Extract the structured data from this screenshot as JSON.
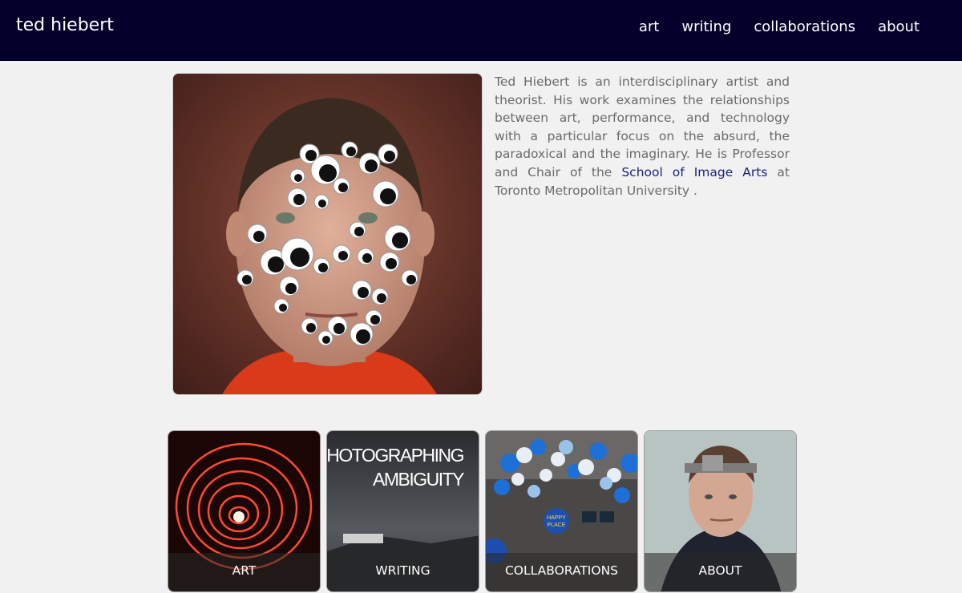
{
  "header": {
    "brand": "ted hiebert",
    "nav": [
      {
        "label": "art"
      },
      {
        "label": "writing"
      },
      {
        "label": "collaborations"
      },
      {
        "label": "about"
      }
    ]
  },
  "colors": {
    "header_bg": "#02002a",
    "page_bg": "#f1f1f1",
    "link": "#1a237e",
    "body_text": "#6a6a6a"
  },
  "bio": {
    "text_before_link": "Ted Hiebert is an interdisciplinary artist and theorist. His work examines the relationships between art, performance, and technology with a particular focus on the absurd, the paradoxical and the imaginary. He is Professor and Chair of the ",
    "link": "School of Image Arts",
    "text_after_link": " at Toronto Metropolitan University ."
  },
  "cards": [
    {
      "label": "ART",
      "image": "red-light-spiral"
    },
    {
      "label": "WRITING",
      "image": "book-cover",
      "image_text": [
        "PHOTOGRAPHING",
        "AMBIGUITY"
      ]
    },
    {
      "label": "COLLABORATIONS",
      "image": "balloon-room",
      "image_text": [
        "HAPPY",
        "PLACE"
      ]
    },
    {
      "label": "ABOUT",
      "image": "man-with-headgear"
    }
  ],
  "portrait": {
    "image": "portrait-googly-eyes"
  }
}
